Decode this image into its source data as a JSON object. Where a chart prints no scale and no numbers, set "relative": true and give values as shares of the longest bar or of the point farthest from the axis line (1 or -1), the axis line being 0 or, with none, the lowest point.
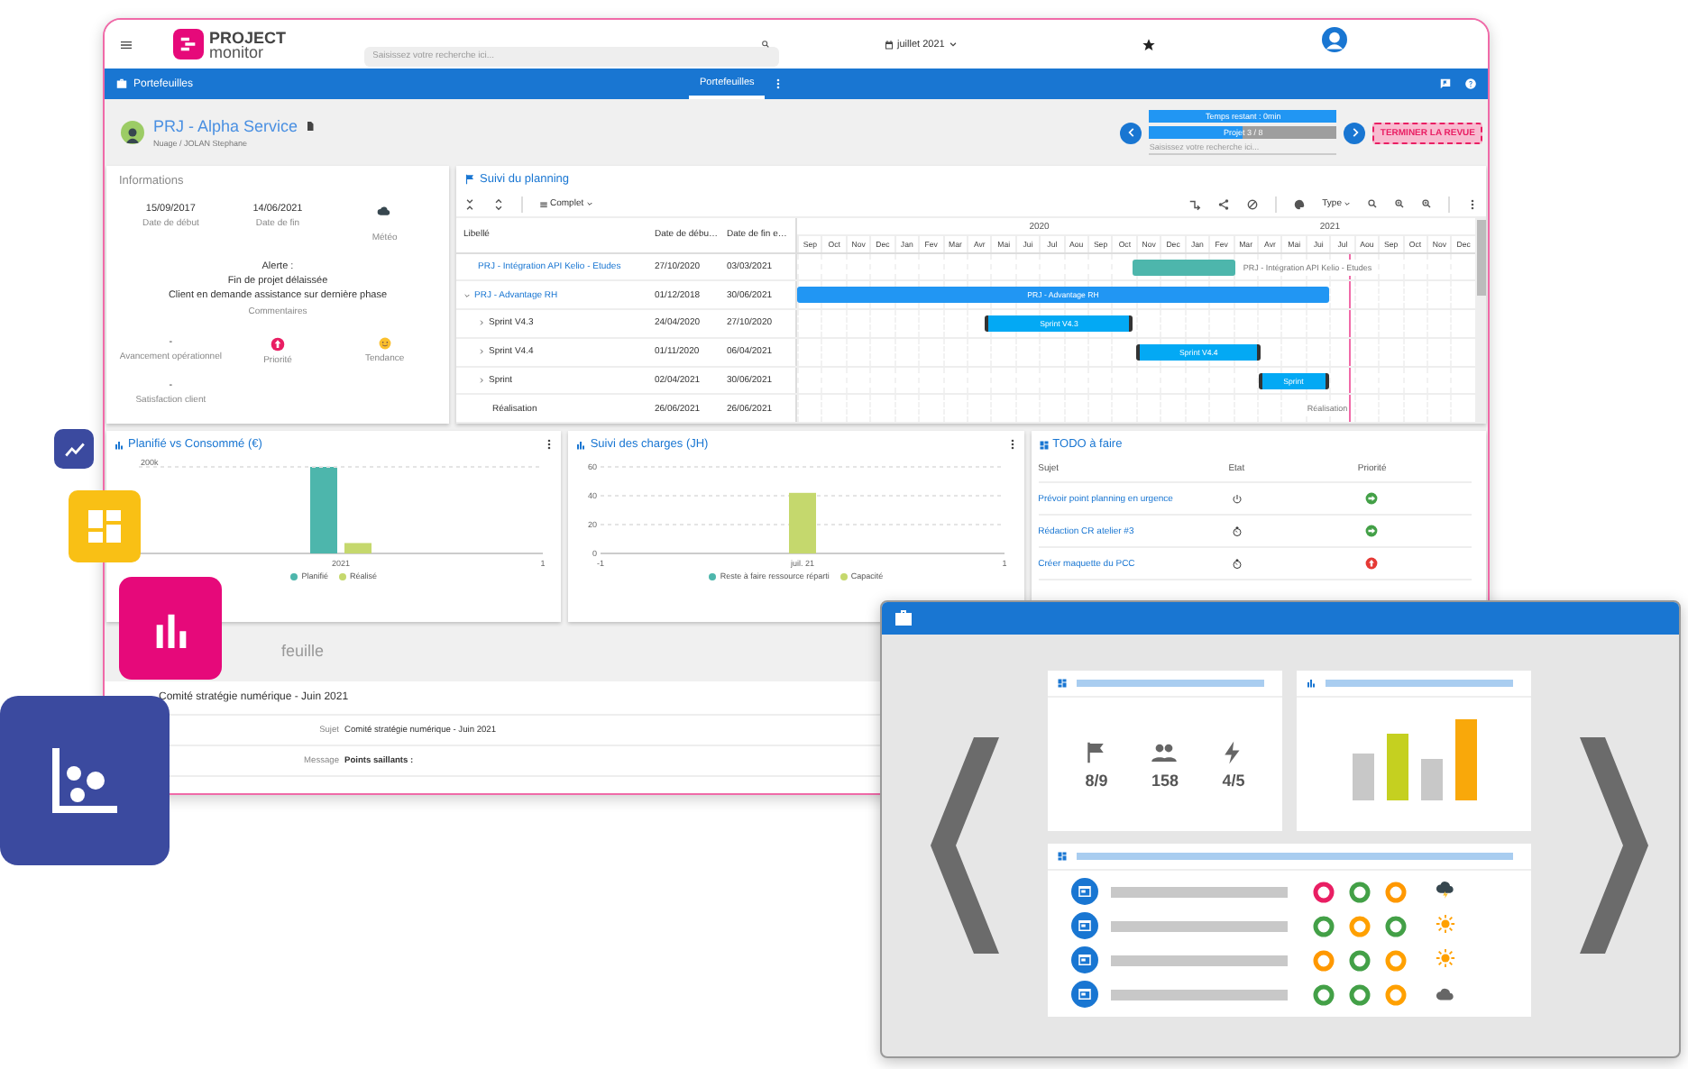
{
  "header": {
    "logo": {
      "line1": "PROJECT",
      "line2": "monitor"
    },
    "search": {
      "placeholder": "Saisissez votre recherche ici..."
    },
    "period": "juillet 2021"
  },
  "nav": {
    "title": "Portefeuilles",
    "tabs": [
      {
        "label": "Portefeuilles",
        "selected": true
      }
    ]
  },
  "project": {
    "title": "PRJ - Alpha Service",
    "subtitle": "Nuage / JOLAN Stephane",
    "timer": {
      "label": "Temps restant : 0min",
      "level": 1
    },
    "progress": {
      "label": "Projet 3 / 8",
      "level": 0.5
    },
    "search": {
      "placeholder": "Saisissez votre recherche ici..."
    },
    "finish_button": "TERMINER LA REVUE"
  },
  "info": {
    "title": "Informations",
    "dates": [
      {
        "value": "15/09/2017",
        "label": "Date de début"
      },
      {
        "value": "14/06/2021",
        "label": "Date de fin"
      }
    ],
    "weather": {
      "kind": "cloud",
      "label": "Météo"
    },
    "alert": [
      "Alerte :",
      "Fin de projet délaissée",
      "Client en demande assistance sur dernière phase"
    ],
    "comments_label": "Commentaires",
    "indicators": [
      {
        "kind": "text",
        "value": "-",
        "label": "Avancement opérationnel"
      },
      {
        "kind": "priority",
        "label": "Priorité"
      },
      {
        "kind": "trend",
        "label": "Tendance"
      }
    ],
    "satisfaction": {
      "value": "-",
      "label": "Satisfaction client"
    }
  },
  "planning": {
    "title": "Suivi du planning",
    "view": "Complet",
    "type_filter": "Type",
    "columns": [
      "Libellé",
      "Date de débu…",
      "Date de fin e…"
    ],
    "years": [
      "2020",
      "2021"
    ],
    "months": [
      "Sep",
      "Oct",
      "Nov",
      "Dec",
      "Jan",
      "Fev",
      "Mar",
      "Avr",
      "Mai",
      "Jui",
      "Jul",
      "Aou",
      "Sep",
      "Oct",
      "Nov",
      "Dec",
      "Jan",
      "Fev",
      "Mar",
      "Avr",
      "Mai",
      "Jui",
      "Jul",
      "Aou",
      "Sep",
      "Oct",
      "Nov",
      "Dec"
    ],
    "rows": [
      {
        "label": "PRJ - Intégration API Kelio - Etudes",
        "start": "27/10/2020",
        "end": "03/03/2021",
        "kind": "project",
        "bar_label": "PRJ - Intégration API Kelio - Etudes"
      },
      {
        "label": "PRJ - Advantage RH",
        "start": "01/12/2018",
        "end": "30/06/2021",
        "kind": "group",
        "bar_label": "PRJ - Advantage RH",
        "expanded": true,
        "children": [
          {
            "label": "Sprint V4.3",
            "start": "24/04/2020",
            "end": "27/10/2020",
            "kind": "sprint",
            "bar_label": "Sprint V4.3",
            "expanded": false
          },
          {
            "label": "Sprint V4.4",
            "start": "01/11/2020",
            "end": "06/04/2021",
            "kind": "sprint",
            "bar_label": "Sprint V4.4",
            "expanded": false
          },
          {
            "label": "Sprint",
            "start": "02/04/2021",
            "end": "30/06/2021",
            "kind": "sprint",
            "bar_label": "Sprint",
            "expanded": false
          },
          {
            "label": "Réalisation",
            "start": "26/06/2021",
            "end": "26/06/2021",
            "kind": "milestone",
            "bar_label": "Réalisation"
          }
        ]
      }
    ]
  },
  "budget": {
    "title": "Planifié vs Consommé (€)",
    "chart_data": {
      "type": "bar",
      "relative": true,
      "categories": [
        "2021"
      ],
      "annotations": [
        {
          "text": "200k"
        },
        {
          "text": "1"
        }
      ],
      "series": [
        {
          "name": "Planifié",
          "color": "#4db6ac",
          "values": [
            1
          ]
        },
        {
          "name": "Réalisé",
          "color": "#c5d86d",
          "values": [
            0.12
          ]
        }
      ]
    }
  },
  "workload": {
    "title": "Suivi des charges (JH)",
    "chart_data": {
      "type": "bar",
      "categories": [
        "juil. 21"
      ],
      "annotations": [
        {
          "text": "-1"
        },
        {
          "text": "1"
        }
      ],
      "ylim": [
        0,
        60
      ],
      "yticks": [
        0,
        20,
        40,
        60
      ],
      "series": [
        {
          "name": "Reste à faire ressource réparti",
          "color": "#4db6ac",
          "values": [
            null
          ]
        },
        {
          "name": "Capacité",
          "color": "#c5d86d",
          "values": [
            42
          ]
        }
      ]
    }
  },
  "todo": {
    "title": "TODO à faire",
    "columns": [
      "Sujet",
      "Etat",
      "Priorité"
    ],
    "rows": [
      {
        "subject": "Prévoir point planning en urgence",
        "state": {
          "kind": "started"
        },
        "priority": {
          "kind": "normal"
        }
      },
      {
        "subject": "Rédaction CR atelier #3",
        "state": {
          "kind": "waiting"
        },
        "priority": {
          "kind": "normal"
        }
      },
      {
        "subject": "Créer maquette du PCC",
        "state": {
          "kind": "waiting"
        },
        "priority": {
          "kind": "high"
        }
      }
    ]
  },
  "reports": {
    "title": "feuille",
    "item": {
      "title": "Comité stratégie numérique - Juin 2021",
      "fields": [
        {
          "label": "Sujet",
          "value": "Comité stratégie numérique - Juin 2021",
          "kind": "plain"
        },
        {
          "label": "Message",
          "value": "Points saillants :",
          "kind": "strong"
        }
      ]
    }
  },
  "preview": {
    "stats": [
      {
        "kind": "flag",
        "value": "8/9"
      },
      {
        "kind": "people",
        "value": "158"
      },
      {
        "kind": "bolt",
        "value": "4/5"
      }
    ],
    "list": [
      {
        "statuses": [
          {
            "color": "#e91e63"
          },
          {
            "color": "#43a047"
          },
          {
            "color": "#ff9800"
          }
        ],
        "weather": {
          "kind": "storm"
        }
      },
      {
        "statuses": [
          {
            "color": "#43a047"
          },
          {
            "color": "#ffa000"
          },
          {
            "color": "#43a047"
          }
        ],
        "weather": {
          "kind": "sun"
        }
      },
      {
        "statuses": [
          {
            "color": "#ff9800"
          },
          {
            "color": "#43a047"
          },
          {
            "color": "#ffa000"
          }
        ],
        "weather": {
          "kind": "sun"
        }
      },
      {
        "statuses": [
          {
            "color": "#43a047"
          },
          {
            "color": "#43a047"
          },
          {
            "color": "#ffa000"
          }
        ],
        "weather": {
          "kind": "cloud"
        }
      }
    ]
  }
}
